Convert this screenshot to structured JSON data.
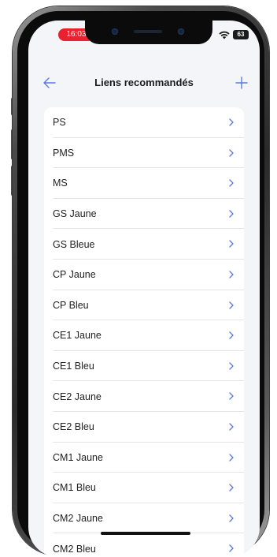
{
  "status_bar": {
    "time": "16:03",
    "battery": "63",
    "colors": {
      "time_pill": "#e8232f"
    }
  },
  "nav": {
    "title": "Liens recommandés",
    "back_icon": "arrow-left-icon",
    "add_icon": "plus-icon",
    "accent_color": "#5b7bd5"
  },
  "list": {
    "items": [
      {
        "label": "PS"
      },
      {
        "label": "PMS"
      },
      {
        "label": "MS"
      },
      {
        "label": "GS Jaune"
      },
      {
        "label": "GS Bleue"
      },
      {
        "label": "CP Jaune"
      },
      {
        "label": "CP Bleu"
      },
      {
        "label": "CE1 Jaune"
      },
      {
        "label": "CE1 Bleu"
      },
      {
        "label": "CE2 Jaune"
      },
      {
        "label": "CE2 Bleu"
      },
      {
        "label": "CM1 Jaune"
      },
      {
        "label": "CM1 Bleu"
      },
      {
        "label": "CM2 Jaune"
      },
      {
        "label": "CM2 Bleu"
      }
    ],
    "chevron_icon": "chevron-right-icon"
  }
}
